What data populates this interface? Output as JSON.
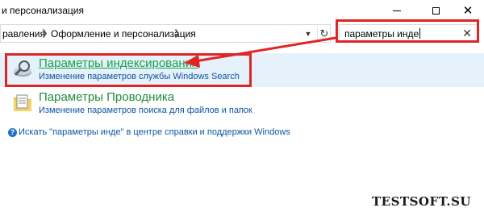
{
  "window": {
    "title": "и персонализация",
    "minimize_icon": "minimize-icon",
    "maximize_icon": "maximize-icon",
    "close_icon": "close-icon"
  },
  "address_bar": {
    "breadcrumbs": [
      "равления",
      "Оформление и персонализация"
    ],
    "separator_icon": "chevron-right-icon",
    "dropdown_icon": "chevron-down-icon",
    "refresh_icon": "refresh-icon"
  },
  "search": {
    "value": "параметры инде",
    "clear_icon": "close-icon"
  },
  "results": [
    {
      "title": "Параметры индексирования",
      "subtitle": "Изменение параметров службы Windows Search",
      "icon": "indexing-options-icon"
    },
    {
      "title": "Параметры Проводника",
      "subtitle": "Изменение параметров поиска для файлов и папок",
      "icon": "folder-options-icon"
    }
  ],
  "help": {
    "text": "Искать \"параметры инде\" в центре справки и поддержки Windows",
    "icon": "help-icon"
  },
  "watermark": "TESTSOFT.SU",
  "colors": {
    "highlight_red": "#e02424",
    "selected_row_bg": "#e5f1fb",
    "link_green": "#16a24a",
    "link_blue": "#0e55a4"
  }
}
